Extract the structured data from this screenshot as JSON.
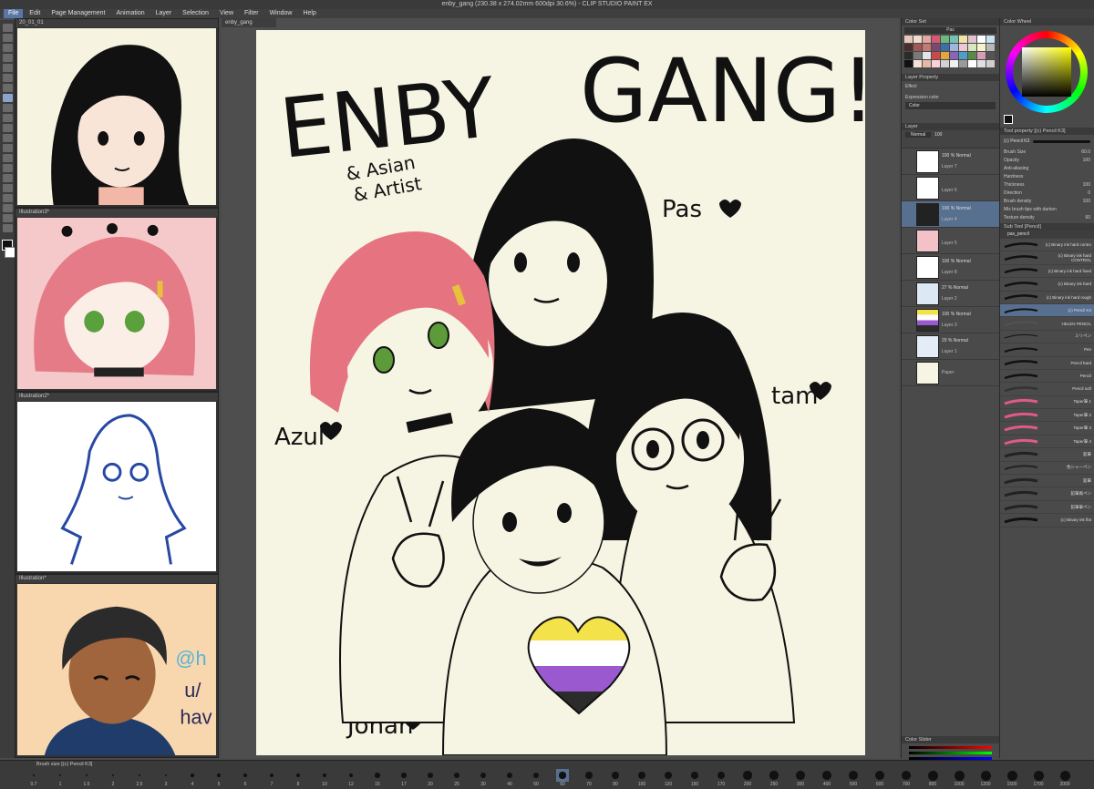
{
  "window": {
    "title": "enby_gang (230.38 x 274.02mm 600dpi 30.6%) - CLIP STUDIO PAINT EX"
  },
  "menu": [
    "File",
    "Edit",
    "Page Management",
    "Animation",
    "Layer",
    "Selection",
    "View",
    "Filter",
    "Window",
    "Help"
  ],
  "doc_tabs": [
    "20_01_01",
    "Illustration3*",
    "Illustration2*",
    "Illustration*"
  ],
  "canvas_tab": "enby_gang",
  "artwork": {
    "title_line1": "ENBY",
    "title_line2": "GANG!",
    "subtitle1": "& Asian",
    "subtitle2": "& Artist",
    "names": {
      "pas": "Pas",
      "azul": "Azul",
      "tam": "tam",
      "johan": "Johan"
    }
  },
  "doc_overlay_text": {
    "line1": "@h",
    "line2": "u/",
    "line3": "hav"
  },
  "panels": {
    "color_set": {
      "title": "Color Set",
      "set_name": "Pas"
    },
    "layer_property": {
      "title": "Layer Property",
      "effect": "Effect",
      "expression_label": "Expression color",
      "expression_value": "Color"
    },
    "layer": {
      "title": "Layer",
      "blend_mode": "Normal",
      "opacity": "100",
      "layers": [
        {
          "mode": "100 % Normal",
          "name": "Layer 7"
        },
        {
          "mode": "",
          "name": "Layer 6"
        },
        {
          "mode": "100 % Normal",
          "name": "Layer 4"
        },
        {
          "mode": "",
          "name": "Layer 5"
        },
        {
          "mode": "100 % Normal",
          "name": "Layer 8"
        },
        {
          "mode": "27 % Normal",
          "name": "Layer 2"
        },
        {
          "mode": "100 % Normal",
          "name": "Layer 3"
        },
        {
          "mode": "20 % Normal",
          "name": "Layer 1"
        },
        {
          "mode": "",
          "name": "Paper"
        }
      ]
    },
    "color_slider": {
      "title": "Color Slider"
    },
    "color_wheel": {
      "title": "Color Wheel"
    },
    "tool_property": {
      "title": "Tool property [(c) Pencil K3]",
      "brush_label": "(c) Pencil K3",
      "props": [
        {
          "label": "Brush Size",
          "value": "60.0"
        },
        {
          "label": "Opacity",
          "value": "100"
        },
        {
          "label": "Anti-aliasing",
          "value": ""
        },
        {
          "label": "Hardness",
          "value": ""
        },
        {
          "label": "Thickness",
          "value": "100"
        },
        {
          "label": "Direction",
          "value": "0"
        },
        {
          "label": "Brush density",
          "value": "100"
        },
        {
          "label": "Mix brush tips with darken",
          "value": ""
        },
        {
          "label": "Texture density",
          "value": "60"
        }
      ]
    },
    "sub_tool": {
      "title": "Sub Tool [Pencil]",
      "group": "pas_pencil",
      "brushes": [
        "(c) Binary ink hard contro",
        "(c) Binary ink hard CONTROL",
        "(c) Binary ink hard fixed",
        "(c) Binary ink hard",
        "(c) Binary ink hard rough",
        "(c) Pencil K3",
        "HELEN PENCIL",
        "ミリペン",
        "Pen",
        "Pencil hard",
        "Pencil",
        "Pencil soft",
        "Taper筆 1",
        "Taper筆 2",
        "Taper筆 3",
        "Taper筆 4",
        "鉛筆",
        "色シャーペン",
        "鉛筆",
        "鉛筆風ペン",
        "鉛筆筆ペン",
        "(c) Binary ink flat"
      ]
    }
  },
  "brush_size_bar": {
    "title": "Brush size [(c) Pencil K3]",
    "sizes": [
      "0.7",
      "1",
      "1.5",
      "2",
      "2.5",
      "3",
      "4",
      "5",
      "6",
      "7",
      "8",
      "10",
      "12",
      "15",
      "17",
      "20",
      "25",
      "30",
      "40",
      "50",
      "60",
      "70",
      "80",
      "100",
      "120",
      "150",
      "170",
      "200",
      "250",
      "300",
      "400",
      "500",
      "600",
      "700",
      "800",
      "1000",
      "1200",
      "1500",
      "1700",
      "2000"
    ]
  },
  "colors": {
    "accent_blue": "#5877a6",
    "paper": "#f6f4e3",
    "nb_yellow": "#f4e24b",
    "nb_white": "#ffffff",
    "nb_purple": "#9a59cf",
    "nb_black": "#2c2c2c"
  }
}
